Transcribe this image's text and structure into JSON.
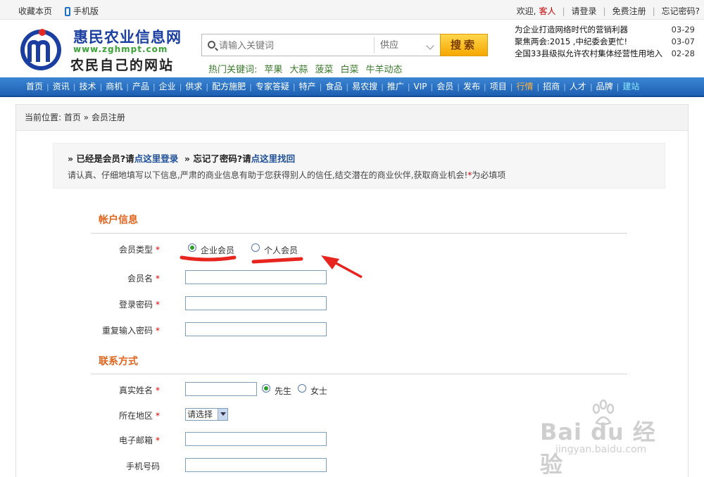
{
  "topbar": {
    "favorite": "收藏本页",
    "mobile": "手机版",
    "welcome": "欢迎,",
    "guest": "客人",
    "login": "请登录",
    "register": "免费注册",
    "forgot": "忘记密码?"
  },
  "header": {
    "logo_title": "惠民农业信息网",
    "logo_url": "www.zghmpt.com",
    "logo_slogan": "农民自己的网站",
    "search_placeholder": "请输入关键词",
    "search_category": "供应",
    "search_button": "搜索",
    "hot_label": "热门关键词:",
    "hot_words": [
      "苹果",
      "大蒜",
      "菠菜",
      "白菜",
      "牛羊动态"
    ]
  },
  "news": [
    {
      "title": "为企业打造网络时代的营销利器",
      "date": "03-29"
    },
    {
      "title": "聚焦两会:2015 ,中纪委会更忙!",
      "date": "03-07"
    },
    {
      "title": "全国33县级拟允许农村集体经营性用地入",
      "date": "02-28"
    }
  ],
  "nav": [
    "首页",
    "资讯",
    "技术",
    "商机",
    "产品",
    "企业",
    "供求",
    "配方施肥",
    "专家答疑",
    "特产",
    "食品",
    "易农搜",
    "推广",
    "VIP",
    "会员",
    "发布",
    "项目",
    "行情",
    "招商",
    "人才",
    "品牌",
    "建站"
  ],
  "breadcrumb": {
    "label": "当前位置:",
    "home": "首页",
    "sep": "»",
    "current": "会员注册"
  },
  "notice": {
    "already": "» 已经是会员?请",
    "login_link": "点这里登录",
    "forgot_q": "» 忘记了密码?请",
    "recover_link": "点这里找回",
    "desc": "请认真、仔细地填写以下信息,严肃的商业信息有助于您获得别人的信任,结交潜在的商业伙伴,获取商业机会!",
    "required_mark": "*",
    "required_note": "为必填项"
  },
  "account": {
    "title": "帐户信息",
    "member_type": "会员类型",
    "type_company": "企业会员",
    "type_personal": "个人会员",
    "username": "会员名",
    "password": "登录密码",
    "password_repeat": "重复输入密码"
  },
  "contact": {
    "title": "联系方式",
    "real_name": "真实姓名",
    "mr": "先生",
    "ms": "女士",
    "region": "所在地区",
    "region_select": "请选择",
    "email": "电子邮箱",
    "mobile": "手机号码"
  },
  "required_star": "*",
  "watermark": {
    "brand": "Bai  du 经验",
    "url": "jingyan.baidu.com"
  },
  "colors": {
    "nav_blue": "#1d5fb2",
    "accent_orange": "#e0641c",
    "annotation_red": "#e8241f",
    "radio_green": "#2aa02a"
  }
}
